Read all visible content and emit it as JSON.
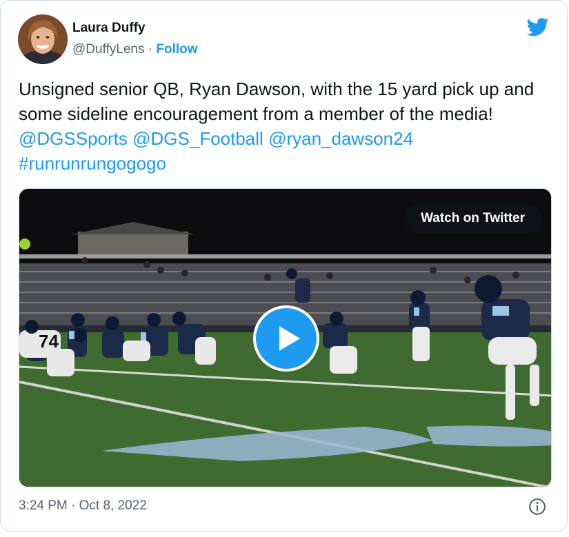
{
  "author": {
    "name": "Laura Duffy",
    "handle": "@DuffyLens",
    "separator": "·",
    "follow_label": "Follow"
  },
  "tweet": {
    "text_plain": "Unsigned senior QB, Ryan Dawson, with the 15 yard pick up and some sideline encouragement from a member of the media! ",
    "mention_1": "@DGSSports",
    "mention_2": "@DGS_Football",
    "mention_3": "@ryan_dawson24",
    "hashtag": "#runrunrungogogo"
  },
  "media": {
    "watch_label": "Watch on Twitter",
    "jersey_number": "74"
  },
  "footer": {
    "timestamp": "3:24 PM · Oct 8, 2022"
  },
  "icons": {
    "brand": "twitter-bird-icon",
    "play": "play-icon",
    "info": "info-icon"
  },
  "colors": {
    "accent": "#1d9bf0",
    "secondary_text": "#536471",
    "field_green": "#3f6b30"
  }
}
